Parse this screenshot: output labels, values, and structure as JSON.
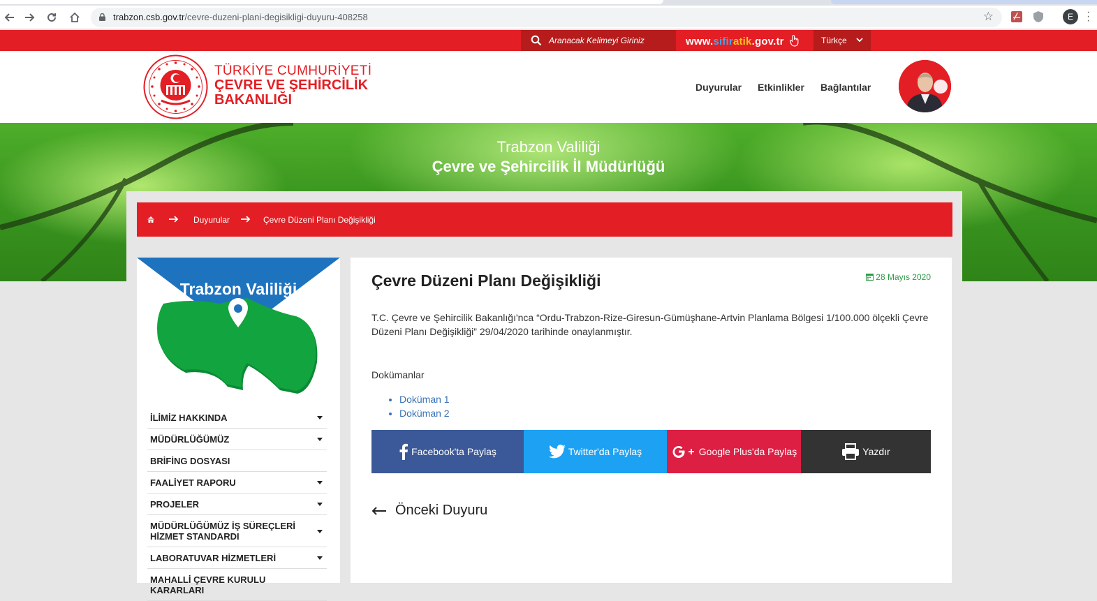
{
  "browser": {
    "url_host": "trabzon.csb.gov.tr",
    "url_path": "/cevre-duzeni-plani-degisikligi-duyuru-408258",
    "profile_initial": "E"
  },
  "topbar": {
    "search_placeholder": "Aranacak Kelimeyi Giriniz",
    "sifir_prefix": "www.",
    "sifir_a": "sifir",
    "sifir_b": "atik",
    "sifir_suffix": ".gov.tr",
    "language": "Türkçe"
  },
  "header": {
    "ministry_line1": "TÜRKİYE CUMHURİYETİ",
    "ministry_line2": "ÇEVRE VE ŞEHİRCİLİK",
    "ministry_line3": "BAKANLIĞI",
    "nav": [
      "Duyurular",
      "Etkinlikler",
      "Bağlantılar"
    ]
  },
  "banner": {
    "line1": "Trabzon Valiliği",
    "line2": "Çevre ve Şehircilik İl Müdürlüğü"
  },
  "breadcrumb": {
    "items": [
      "Duyurular",
      "Çevre Düzeni Planı Değişikliği"
    ]
  },
  "sidebar": {
    "title": "Trabzon Valiliği",
    "menu": [
      {
        "label": "İLİMİZ HAKKINDA",
        "has_sub": true
      },
      {
        "label": "MÜDÜRLÜĞÜMÜZ",
        "has_sub": true
      },
      {
        "label": "BRİFİNG DOSYASI",
        "has_sub": false
      },
      {
        "label": "FAALİYET RAPORU",
        "has_sub": true
      },
      {
        "label": "PROJELER",
        "has_sub": true
      },
      {
        "label": "MÜDÜRLÜĞÜMÜZ İŞ SÜREÇLERİ HİZMET STANDARDI",
        "has_sub": true
      },
      {
        "label": "LABORATUVAR HİZMETLERİ",
        "has_sub": true
      },
      {
        "label": "MAHALLİ ÇEVRE KURULU KARARLARI",
        "has_sub": false
      }
    ]
  },
  "article": {
    "title": "Çevre Düzeni Planı Değişikliği",
    "date": "28 Mayıs 2020",
    "body": "T.C. Çevre ve Şehircilik Bakanlığı'nca  “Ordu-Trabzon-Rize-Giresun-Gümüşhane-Artvin Planlama Bölgesi 1/100.000 ölçekli Çevre Düzeni Planı Değişikliği” 29/04/2020 tarihinde onaylanmıştır.",
    "docs_heading": "Dokümanlar",
    "docs": [
      "Doküman 1",
      "Doküman 2"
    ],
    "share": {
      "facebook": "Facebook'ta Paylaş",
      "twitter": "Twitter'da Paylaş",
      "google": "Google Plus'da Paylaş",
      "print": "Yazdır"
    },
    "prev_label": "Önceki Duyuru"
  },
  "colors": {
    "brand_red": "#e31e24",
    "facebook": "#3b5998",
    "twitter": "#1da1f2",
    "google": "#dd1f43",
    "print": "#333333",
    "date_green": "#2e9b4a"
  }
}
